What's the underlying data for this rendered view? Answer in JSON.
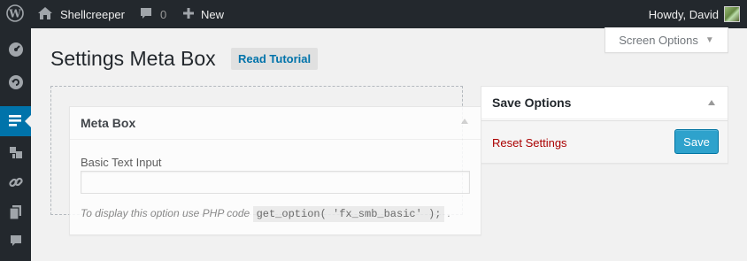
{
  "admin_bar": {
    "site_name": "Shellcreeper",
    "comments_count": "0",
    "new_label": "New",
    "howdy": "Howdy, David"
  },
  "admin_menu": {
    "icons": [
      "dashboard-icon",
      "updates-icon",
      "settings-page-icon",
      "plugins-icon",
      "links-icon",
      "pages-icon",
      "comments-icon"
    ]
  },
  "screen_options": {
    "label": "Screen Options"
  },
  "page": {
    "title": "Settings Meta Box",
    "tutorial_button": "Read Tutorial"
  },
  "meta_box": {
    "title": "Meta Box",
    "field_label": "Basic Text Input",
    "field_value": "",
    "description_prefix": "To display this option use PHP code",
    "description_code": "get_option( 'fx_smb_basic' );",
    "description_suffix": "."
  },
  "save_box": {
    "title": "Save Options",
    "reset_label": "Reset Settings",
    "save_label": "Save"
  },
  "colors": {
    "admin_bar_bg": "#23282d",
    "accent": "#0073aa",
    "save_button": "#2ea2cc",
    "reset_link": "#aa0000"
  }
}
